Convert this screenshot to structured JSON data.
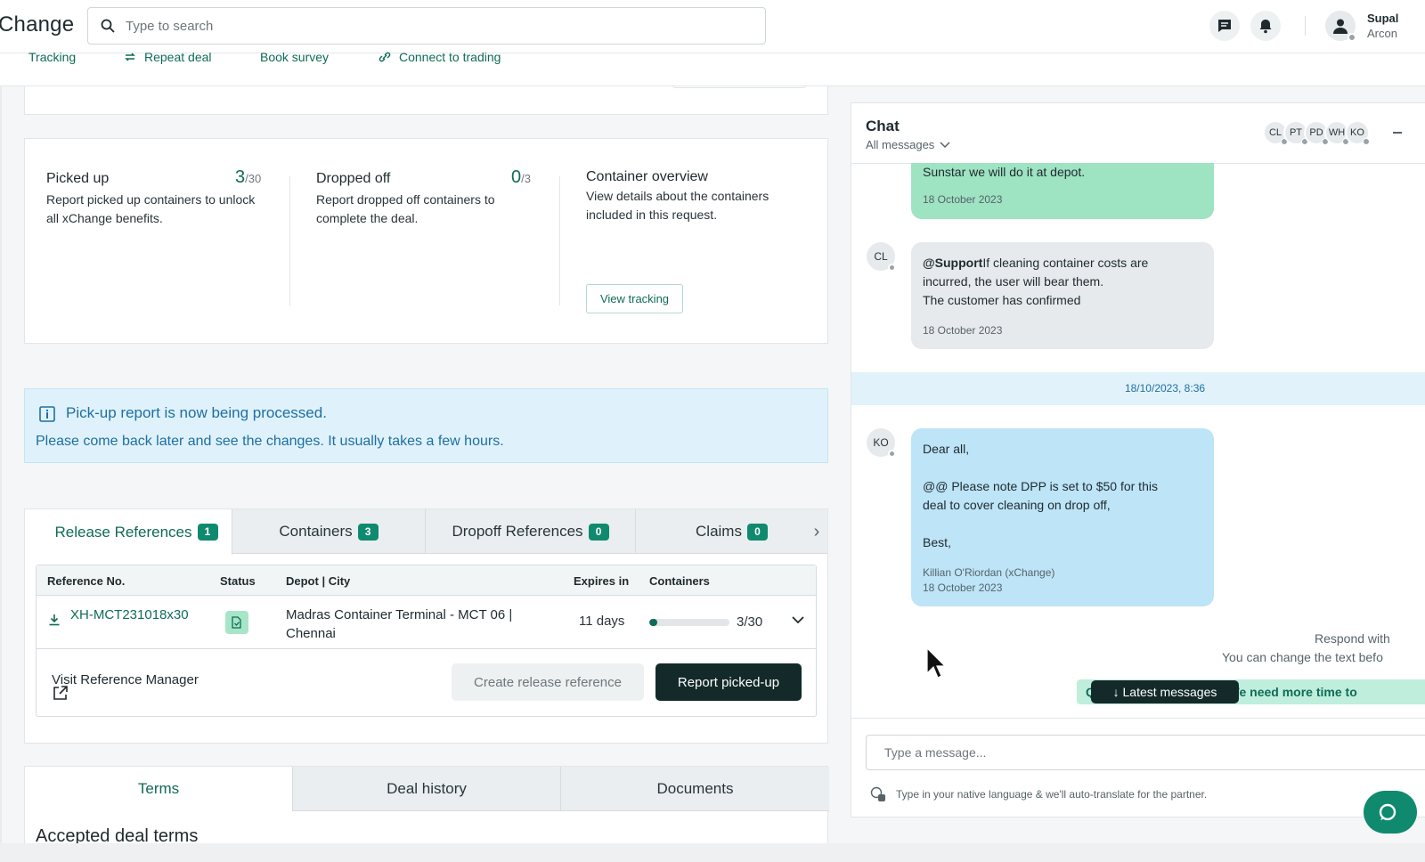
{
  "header": {
    "logo": "Change",
    "search_placeholder": "Type to search",
    "user_name": "Supal",
    "user_org": "Arcon"
  },
  "actions": {
    "tracking": "Tracking",
    "repeat_deal": "Repeat deal",
    "book_survey": "Book survey",
    "connect_trading": "Connect to trading"
  },
  "stats": {
    "picked_up": {
      "title": "Picked up",
      "count": "3",
      "total": "/30",
      "desc": "Report picked up containers to unlock all xChange benefits."
    },
    "dropped_off": {
      "title": "Dropped off",
      "count": "0",
      "total": "/3",
      "desc": "Report dropped off containers to complete the deal."
    },
    "overview": {
      "title": "Container overview",
      "desc": "View details about the containers included in this request.",
      "button": "View tracking"
    }
  },
  "banner": {
    "title": "Pick-up report is now being processed.",
    "text": "Please come back later and see the changes. It usually takes a few hours."
  },
  "tabs": [
    {
      "label": "Release References",
      "count": "1"
    },
    {
      "label": "Containers",
      "count": "3"
    },
    {
      "label": "Dropoff References",
      "count": "0"
    },
    {
      "label": "Claims",
      "count": "0"
    }
  ],
  "table": {
    "headers": [
      "Reference No.",
      "Status",
      "Depot | City",
      "Expires in",
      "Containers"
    ],
    "row": {
      "ref": "XH-MCT231018x30",
      "depot": "Madras Container Terminal - MCT 06 | Chennai",
      "expires": "11 days",
      "progress": 0.1,
      "progress_text": "3/30"
    },
    "visit": "Visit Reference Manager",
    "create_btn": "Create release reference",
    "report_btn": "Report picked-up"
  },
  "bottom_tabs": [
    "Terms",
    "Deal history",
    "Documents"
  ],
  "terms_heading": "Accepted deal terms",
  "chat": {
    "title": "Chat",
    "filter": "All messages",
    "participants": [
      "CL",
      "PT",
      "PD",
      "WH",
      "KO"
    ],
    "msg1": {
      "text": "Sunstar we will do it at depot.",
      "date": "18 October 2023"
    },
    "msg2": {
      "avatar": "CL",
      "mention": "@Support",
      "line1": "If cleaning container costs are",
      "line2": "incurred, the user will bear them.",
      "line3": "The customer has confirmed",
      "date": "18 October 2023"
    },
    "timestamp": "18/10/2023, 8:36",
    "msg3": {
      "avatar": "KO",
      "line1": "Dear all,",
      "line2": "@@  Please note DPP is set to $50 for this",
      "line3": "deal to cover cleaning on drop off,",
      "line4": "Best,",
      "author": "Killian O'Riordan (xChange)",
      "date": "18 October 2023"
    },
    "respond_line1": "Respond with",
    "respond_line2": "You can change the text befo",
    "quick_reply": "Q         Latest messages      se? We need more time to",
    "latest_btn": "Latest messages",
    "input_placeholder": "Type a message...",
    "translate_note": "Type in your native language & we'll auto-translate for the partner."
  },
  "colors": {
    "accent": "#0f6b57",
    "dark_button": "#142a2a",
    "info_bg": "#dff2fb",
    "bubble_green": "#9ee3c2",
    "bubble_blue": "#bde4f7"
  }
}
